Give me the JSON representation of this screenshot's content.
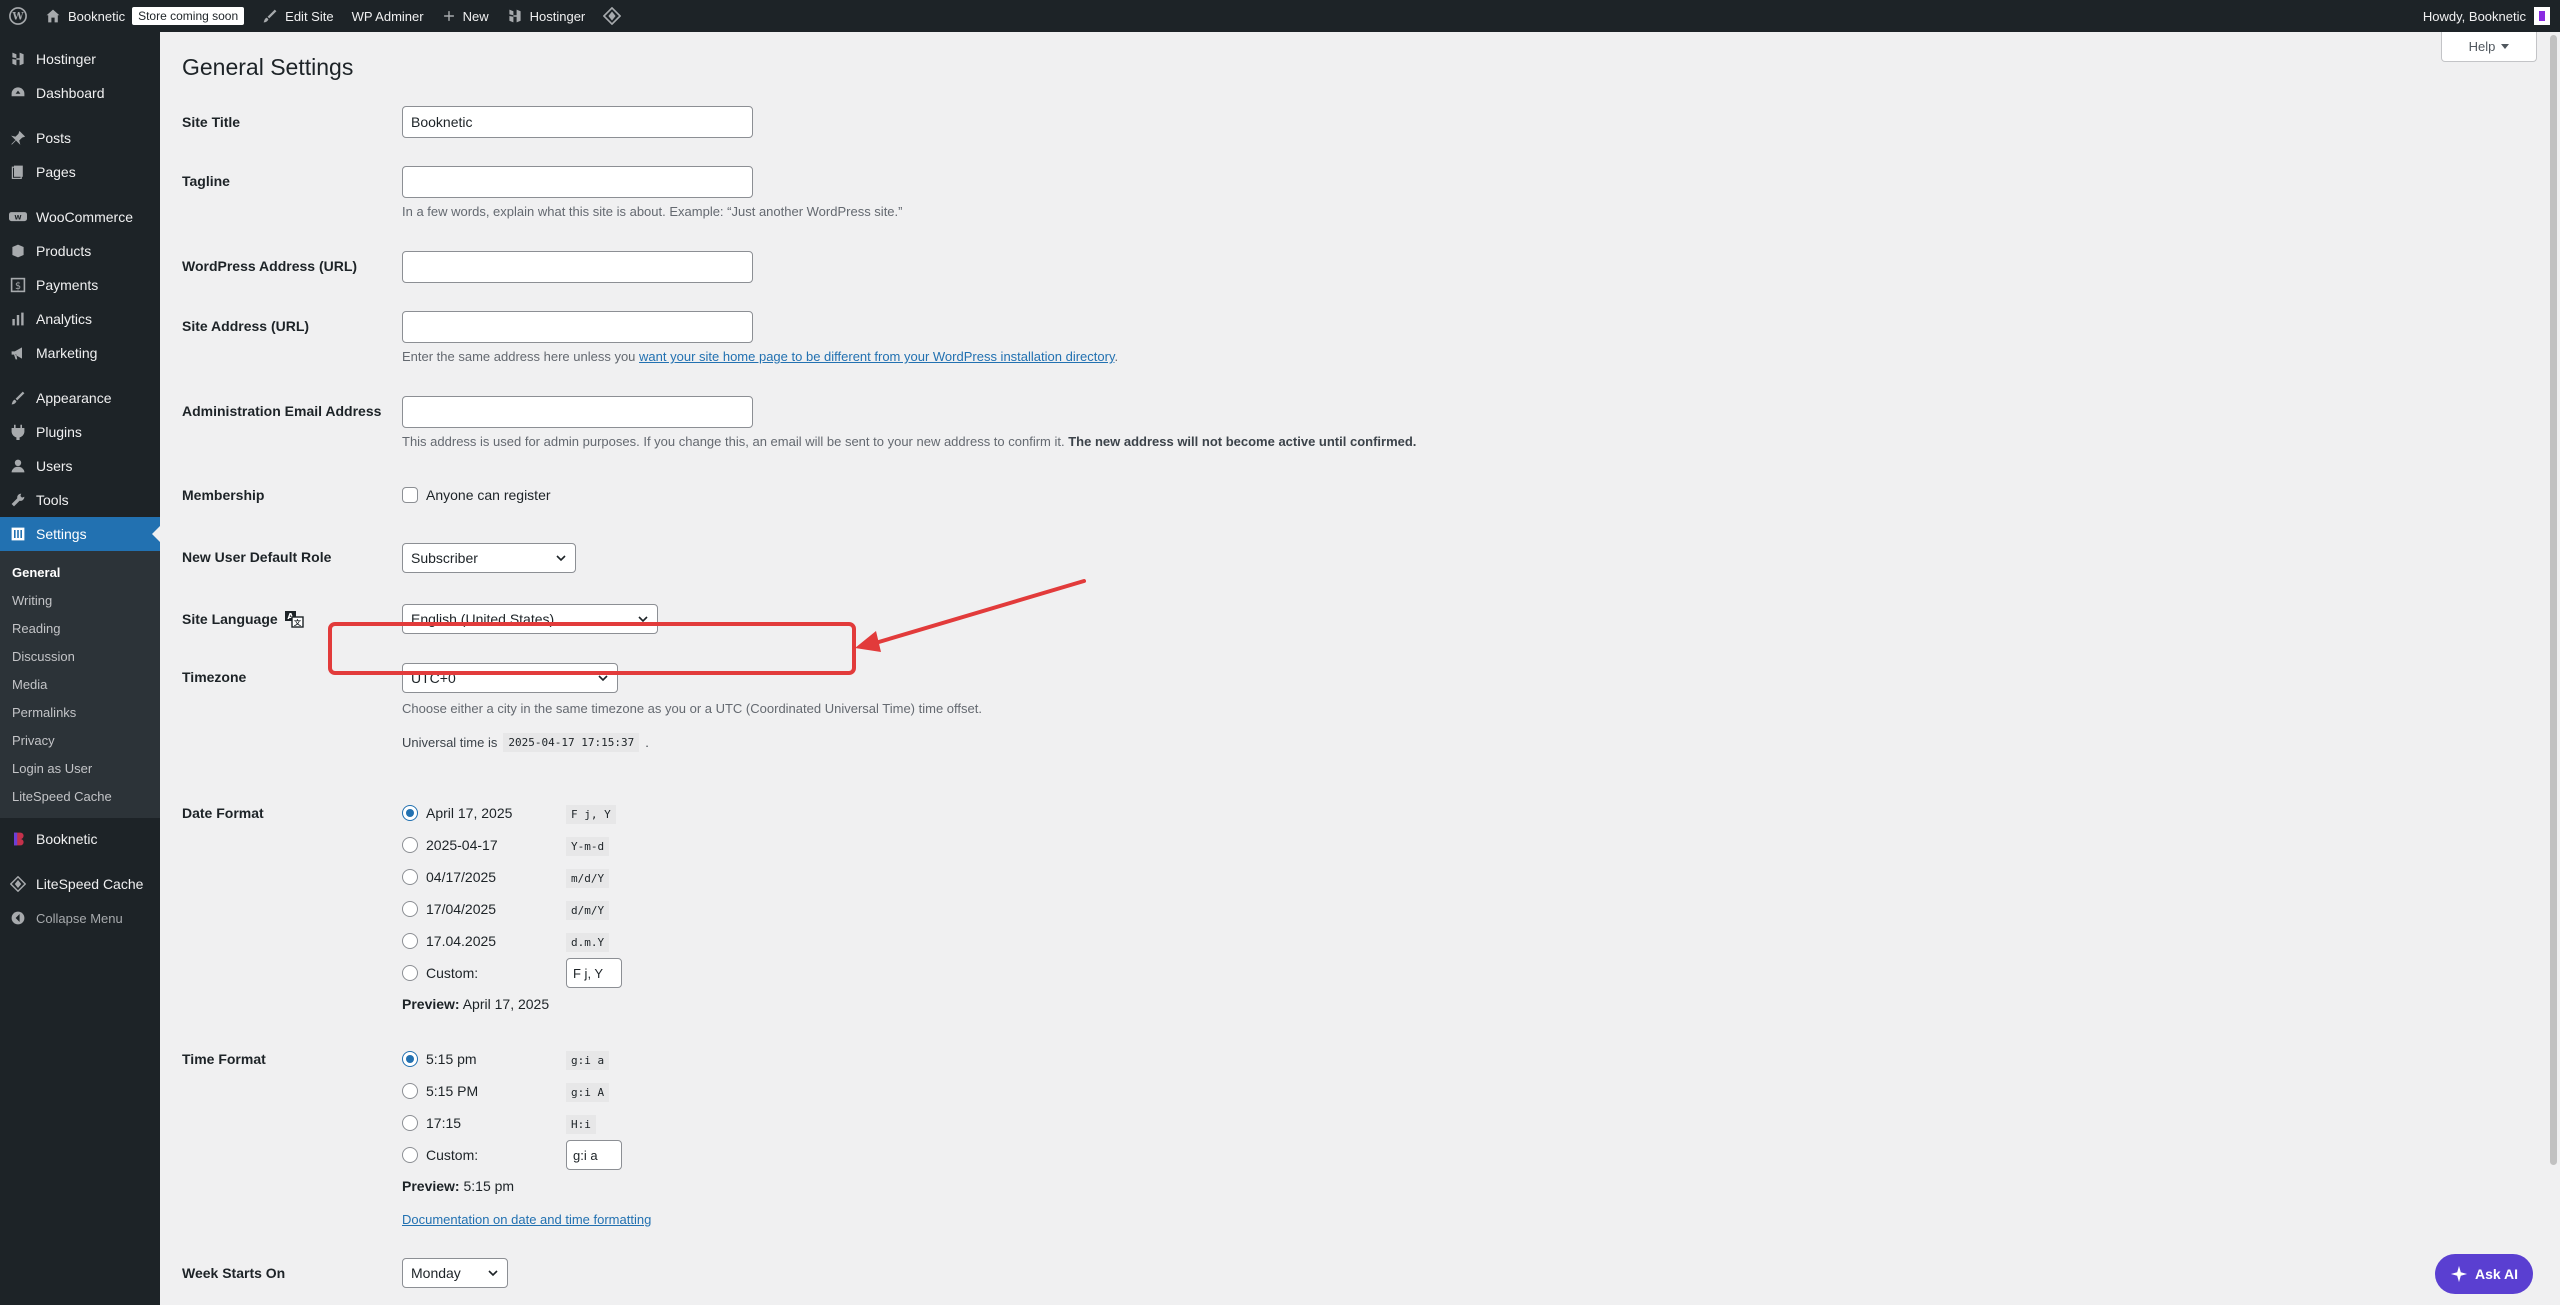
{
  "adminbar": {
    "site_name": "Booknetic",
    "store_badge": "Store coming soon",
    "edit_site": "Edit Site",
    "wp_adminer": "WP Adminer",
    "new": "New",
    "hostinger": "Hostinger",
    "howdy": "Howdy, Booknetic"
  },
  "sidebar": {
    "items": [
      {
        "label": "Hostinger",
        "icon": "hostinger-icon"
      },
      {
        "label": "Dashboard",
        "icon": "dashboard-icon"
      },
      {
        "label": "Posts",
        "icon": "pin-icon"
      },
      {
        "label": "Pages",
        "icon": "pages-icon"
      },
      {
        "label": "WooCommerce",
        "icon": "woocommerce-icon"
      },
      {
        "label": "Products",
        "icon": "products-icon"
      },
      {
        "label": "Payments",
        "icon": "payments-icon"
      },
      {
        "label": "Analytics",
        "icon": "analytics-icon"
      },
      {
        "label": "Marketing",
        "icon": "megaphone-icon"
      },
      {
        "label": "Appearance",
        "icon": "brush-icon"
      },
      {
        "label": "Plugins",
        "icon": "plug-icon"
      },
      {
        "label": "Users",
        "icon": "users-icon"
      },
      {
        "label": "Tools",
        "icon": "wrench-icon"
      },
      {
        "label": "Settings",
        "icon": "settings-icon"
      }
    ],
    "submenu": [
      "General",
      "Writing",
      "Reading",
      "Discussion",
      "Media",
      "Permalinks",
      "Privacy",
      "Login as User",
      "LiteSpeed Cache"
    ],
    "after": [
      {
        "label": "Booknetic",
        "icon": "booknetic-icon"
      },
      {
        "label": "LiteSpeed Cache",
        "icon": "litespeed-icon"
      },
      {
        "label": "Collapse Menu",
        "icon": "collapse-icon"
      }
    ]
  },
  "main": {
    "help": "Help",
    "title": "General Settings",
    "site_title_label": "Site Title",
    "site_title_value": "Booknetic",
    "tagline_label": "Tagline",
    "tagline_value": "",
    "tagline_desc": "In a few words, explain what this site is about. Example: “Just another WordPress site.”",
    "wp_address_label": "WordPress Address (URL)",
    "wp_address_value": "",
    "site_address_label": "Site Address (URL)",
    "site_address_value": "",
    "site_address_desc_pre": "Enter the same address here unless you ",
    "site_address_desc_link": "want your site home page to be different from your WordPress installation directory",
    "site_address_desc_post": ".",
    "admin_email_label": "Administration Email Address",
    "admin_email_value": "",
    "admin_email_desc": "This address is used for admin purposes. If you change this, an email will be sent to your new address to confirm it.",
    "admin_email_desc_bold": "The new address will not become active until confirmed.",
    "membership_label": "Membership",
    "membership_option": "Anyone can register",
    "default_role_label": "New User Default Role",
    "default_role_value": "Subscriber",
    "site_language_label": "Site Language",
    "site_language_value": "English (United States)",
    "timezone_label": "Timezone",
    "timezone_value": "UTC+0",
    "timezone_desc": "Choose either a city in the same timezone as you or a UTC (Coordinated Universal Time) time offset.",
    "universal_time_label": "Universal time is",
    "universal_time_value": "2025-04-17 17:15:37",
    "date_format_label": "Date Format",
    "date_options": [
      {
        "label": "April 17, 2025",
        "code": "F j, Y",
        "checked": true
      },
      {
        "label": "2025-04-17",
        "code": "Y-m-d",
        "checked": false
      },
      {
        "label": "04/17/2025",
        "code": "m/d/Y",
        "checked": false
      },
      {
        "label": "17/04/2025",
        "code": "d/m/Y",
        "checked": false
      },
      {
        "label": "17.04.2025",
        "code": "d.m.Y",
        "checked": false
      },
      {
        "label": "Custom:",
        "code": "F j, Y",
        "checked": false
      }
    ],
    "date_preview_label": "Preview:",
    "date_preview_value": "April 17, 2025",
    "time_format_label": "Time Format",
    "time_options": [
      {
        "label": "5:15 pm",
        "code": "g:i a",
        "checked": true
      },
      {
        "label": "5:15 PM",
        "code": "g:i A",
        "checked": false
      },
      {
        "label": "17:15",
        "code": "H:i",
        "checked": false
      },
      {
        "label": "Custom:",
        "code": "g:i a",
        "checked": false
      }
    ],
    "time_preview_label": "Preview:",
    "time_preview_value": "5:15 pm",
    "doc_link": "Documentation on date and time formatting",
    "week_starts_label": "Week Starts On",
    "week_starts_value": "Monday",
    "ask_ai": "Ask AI"
  },
  "colors": {
    "admin_dark": "#1d2327",
    "accent": "#2271b1",
    "highlight": "#e23b3b",
    "ask_ai": "#5a3fd1"
  }
}
